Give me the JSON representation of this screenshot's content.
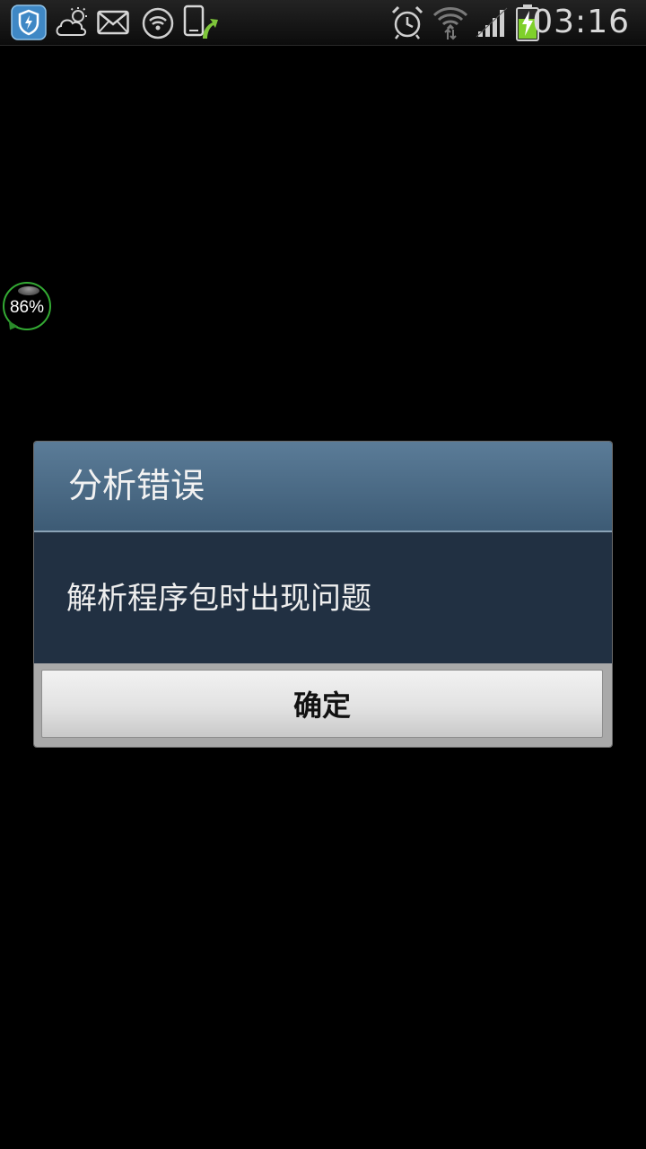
{
  "status_bar": {
    "time": "03:16",
    "left_icons": [
      "shield-notification-icon",
      "weather-cloud-icon",
      "mail-icon",
      "wifi-hotspot-icon",
      "phone-upload-icon"
    ],
    "right_icons": [
      "alarm-clock-icon",
      "wifi-signal-icon",
      "cell-signal-icon",
      "battery-charging-icon"
    ]
  },
  "floating_widget": {
    "value": "86%"
  },
  "dialog": {
    "title": "分析错误",
    "message": "解析程序包时出现问题",
    "ok_label": "确定"
  },
  "colors": {
    "header_bg": "#4d6d88",
    "body_bg": "#213042",
    "footer_bg": "#a9a9a9",
    "widget_ring": "#33aa33",
    "battery_green": "#7fd02a"
  }
}
